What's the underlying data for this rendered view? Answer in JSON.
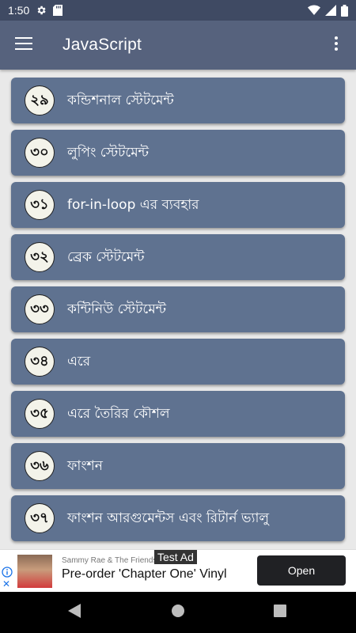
{
  "status_bar": {
    "time": "1:50",
    "icons": [
      "gear-icon",
      "sd-card-icon",
      "wifi-icon",
      "signal-icon",
      "battery-icon"
    ]
  },
  "app_bar": {
    "title": "JavaScript",
    "icons": [
      "hamburger-menu-icon",
      "more-vert-icon"
    ]
  },
  "lessons": [
    {
      "number": "২৯",
      "title": "কন্ডিশনাল স্টেটমেন্ট"
    },
    {
      "number": "৩০",
      "title": "লুপিং স্টেটমেন্ট"
    },
    {
      "number": "৩১",
      "title": "for-in-loop এর ব্যবহার"
    },
    {
      "number": "৩২",
      "title": "ব্রেক স্টেটমেন্ট"
    },
    {
      "number": "৩৩",
      "title": "কন্টিনিউ স্টেটমেন্ট"
    },
    {
      "number": "৩৪",
      "title": "এরে"
    },
    {
      "number": "৩৫",
      "title": "এরে তৈরির কৌশল"
    },
    {
      "number": "৩৬",
      "title": "ফাংশন"
    },
    {
      "number": "৩৭",
      "title": "ফাংশন আরগুমেন্টস এবং রিটার্ন ভ্যালু"
    }
  ],
  "ad": {
    "label": "Test Ad",
    "subtitle": "Sammy Rae & The Friends",
    "title": "Pre-order 'Chapter One' Vinyl",
    "cta": "Open"
  },
  "nav_bar": {
    "icons": [
      "back-icon",
      "home-icon",
      "recents-icon"
    ]
  },
  "colors": {
    "status_bar": "#3f4a63",
    "app_bar": "#56627d",
    "card": "#5f7290",
    "background": "#e9e9e9"
  }
}
